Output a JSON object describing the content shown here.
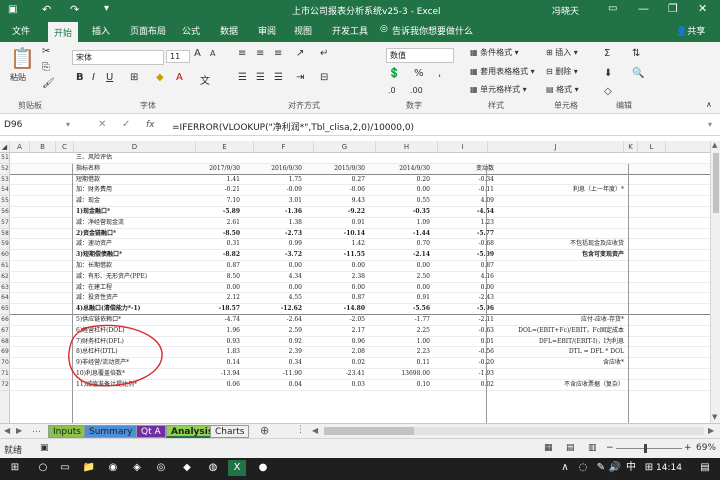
{
  "title_bar": {
    "title": "上市公司报表分析系统v25-3  -  Excel",
    "user": "冯晓天"
  },
  "ribbon_tabs": [
    "文件",
    "开始",
    "插入",
    "页面布局",
    "公式",
    "数据",
    "审阅",
    "视图",
    "开发工具"
  ],
  "active_tab": "开始",
  "tell_me": "告诉我你想要做什么",
  "share": "共享",
  "ribbon": {
    "paste": "粘贴",
    "clipboard": "剪贴板",
    "font_name": "宋体",
    "font_size": "11",
    "font_group": "字体",
    "align_group": "对齐方式",
    "number_format": "数值",
    "number_group": "数字",
    "cond_format": "条件格式",
    "table_format": "套用表格格式",
    "cell_style": "单元格样式",
    "style_group": "样式",
    "insert": "插入",
    "delete": "删除",
    "format": "格式",
    "cells_group": "单元格",
    "edit_group": "编辑"
  },
  "formula_bar": {
    "name_box": "D96",
    "fx": "fx",
    "formula": "=IFERROR(VLOOKUP(\"净利润*\",Tbl_clisa,2,0)/10000,0)"
  },
  "columns": [
    "A",
    "B",
    "C",
    "D",
    "E",
    "F",
    "G",
    "H",
    "I",
    "J",
    "K",
    "L"
  ],
  "section_title": "三、风险评估",
  "header_row": {
    "label": "指标名称",
    "c1": "2017/9/30",
    "c2": "2016/9/30",
    "c3": "2015/9/30",
    "c4": "2014/9/30",
    "c5": "变动数"
  },
  "rows": [
    {
      "n": "53",
      "label": "短期借款",
      "v": [
        "1.41",
        "1.75",
        "0.27",
        "0.20",
        "-0.34"
      ],
      "note": ""
    },
    {
      "n": "54",
      "label": "加：财务费用",
      "v": [
        "-0.21",
        "-0.09",
        "-0.06",
        "0.00",
        "-0.11"
      ],
      "note": "利息（上一年度）*"
    },
    {
      "n": "55",
      "label": "减：现金",
      "v": [
        "7.10",
        "3.01",
        "9.43",
        "0.55",
        "4.09"
      ],
      "note": ""
    },
    {
      "n": "56",
      "label": "1)现金融口*",
      "v": [
        "-5.89",
        "-1.36",
        "-9.22",
        "-0.35",
        "-4.54"
      ],
      "note": "",
      "bold": true
    },
    {
      "n": "57",
      "label": "减：净经营现金流",
      "v": [
        "2.61",
        "1.38",
        "0.91",
        "1.09",
        "1.23"
      ],
      "note": ""
    },
    {
      "n": "58",
      "label": "2)资金链融口*",
      "v": [
        "-8.50",
        "-2.73",
        "-10.14",
        "-1.44",
        "-5.77"
      ],
      "note": "",
      "bold": true
    },
    {
      "n": "59",
      "label": "减：速动资产",
      "v": [
        "0.31",
        "0.99",
        "1.42",
        "0.70",
        "-0.68"
      ],
      "note": "不包括现金及应收货"
    },
    {
      "n": "60",
      "label": "3)短期偿债融口*",
      "v": [
        "-8.82",
        "-3.72",
        "-11.55",
        "-2.14",
        "-5.09"
      ],
      "note": "包含可变现资产",
      "bold": true
    },
    {
      "n": "61",
      "label": "加：长期借款",
      "v": [
        "0.87",
        "0.00",
        "0.00",
        "0.00",
        "0.87"
      ],
      "note": ""
    },
    {
      "n": "62",
      "label": "减：有形、无形资产(PPE)",
      "v": [
        "8.50",
        "4.34",
        "2.38",
        "2.50",
        "4.16"
      ],
      "note": ""
    },
    {
      "n": "63",
      "label": "减：在建工程",
      "v": [
        "0.00",
        "0.00",
        "0.00",
        "0.00",
        "0.00"
      ],
      "note": ""
    },
    {
      "n": "64",
      "label": "减：投资性资产",
      "v": [
        "2.12",
        "4.55",
        "0.87",
        "0.91",
        "-2.43"
      ],
      "note": ""
    },
    {
      "n": "65",
      "label": "4)总融口(清偿能力*-1)",
      "v": [
        "-18.57",
        "-12.62",
        "-14.80",
        "-5.56",
        "-5.96"
      ],
      "note": "",
      "bold": true,
      "sep": true
    },
    {
      "n": "66",
      "label": "5)供应链依赖口*",
      "v": [
        "-4.74",
        "-2.64",
        "-2.05",
        "-1.77",
        "-2.11"
      ],
      "note": "应付-应收-存货*"
    },
    {
      "n": "67",
      "label": "6)经营杠杆(DOL)",
      "v": [
        "1.96",
        "2.59",
        "2.17",
        "2.25",
        "-0.63"
      ],
      "note": "DOL=(EBIT+Fc)/EBIT，Fc固定成本"
    },
    {
      "n": "68",
      "label": "7)财务杠杆(DFL)",
      "v": [
        "0.93",
        "0.92",
        "0.96",
        "1.00",
        "0.01"
      ],
      "note": "DFL=EBIT/(EBIT-I)，I为利息"
    },
    {
      "n": "69",
      "label": "8)总杠杆(DTL)",
      "v": [
        "1.83",
        "2.39",
        "2.08",
        "2.23",
        "-0.56"
      ],
      "note": "DTL = DFL * DOL"
    },
    {
      "n": "70",
      "label": "9)非经营/流动资产*",
      "v": [
        "0.14",
        "0.34",
        "0.02",
        "0.11",
        "-0.20"
      ],
      "note": "含应收*"
    },
    {
      "n": "71",
      "label": "10)利息覆盖倍数*",
      "v": [
        "-13.94",
        "-11.90",
        "-23.41",
        "13698.00",
        "-1.93"
      ],
      "note": ""
    },
    {
      "n": "72",
      "label": "11)减值准备计提比例*",
      "v": [
        "0.06",
        "0.04",
        "0.03",
        "0.10",
        "0.02"
      ],
      "note": "不含应收票据（复杂）"
    }
  ],
  "first_rows": [
    "51",
    "52"
  ],
  "sheet_tabs": [
    "Inputs",
    "Summary",
    "Qt A",
    "Analysis",
    "Charts"
  ],
  "active_sheet": "Analysis",
  "tab_colors": {
    "Inputs": "#8ac24a",
    "Summary": "#4a90d9",
    "Qt A": "#7030a0",
    "Analysis": "#92d050",
    "Charts": "#f0f0f0"
  },
  "status": {
    "ready": "就绪",
    "zoom": "69%"
  },
  "taskbar": {
    "time": "14:14",
    "lang": "中"
  },
  "accent": "#217346",
  "annotation_color": "#d9262b"
}
